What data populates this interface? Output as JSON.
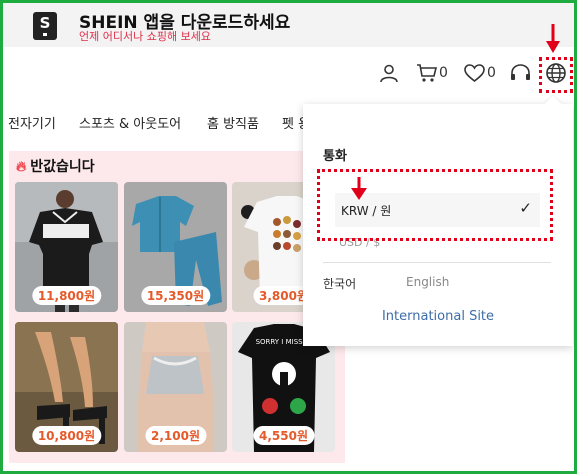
{
  "banner": {
    "logo_letter": "S",
    "title": "SHEIN 앱을 다운로드하세요",
    "subtitle": "언제 어디서나 쇼핑해 보세요"
  },
  "header": {
    "cart_count": "0",
    "wishlist_count": "0"
  },
  "nav": {
    "categories": [
      "전자기기",
      "스포츠 & 아웃도어",
      "홈 방직품",
      "펫 용"
    ]
  },
  "deals": {
    "title": "반값습니다",
    "products": [
      {
        "price": "11,800원"
      },
      {
        "price": "15,350원"
      },
      {
        "price": "3,800원"
      },
      {
        "price": "10,800원"
      },
      {
        "price": "2,100원"
      },
      {
        "price": "4,550원"
      }
    ],
    "shirt_text": "SORRY I MISSED"
  },
  "dropdown": {
    "currency_heading": "통화",
    "selected_currency": "KRW / 원",
    "check_mark": "✓",
    "other_currency": "USD / $",
    "languages": [
      "한국어",
      "English"
    ],
    "international_link": "International Site"
  },
  "colors": {
    "frame": "#1eab3f",
    "annotation": "#e0001a",
    "price_text": "#e45a2b",
    "deal_bg": "#fde9ec",
    "link": "#3d6da8",
    "subtitle": "#e02e4a"
  }
}
